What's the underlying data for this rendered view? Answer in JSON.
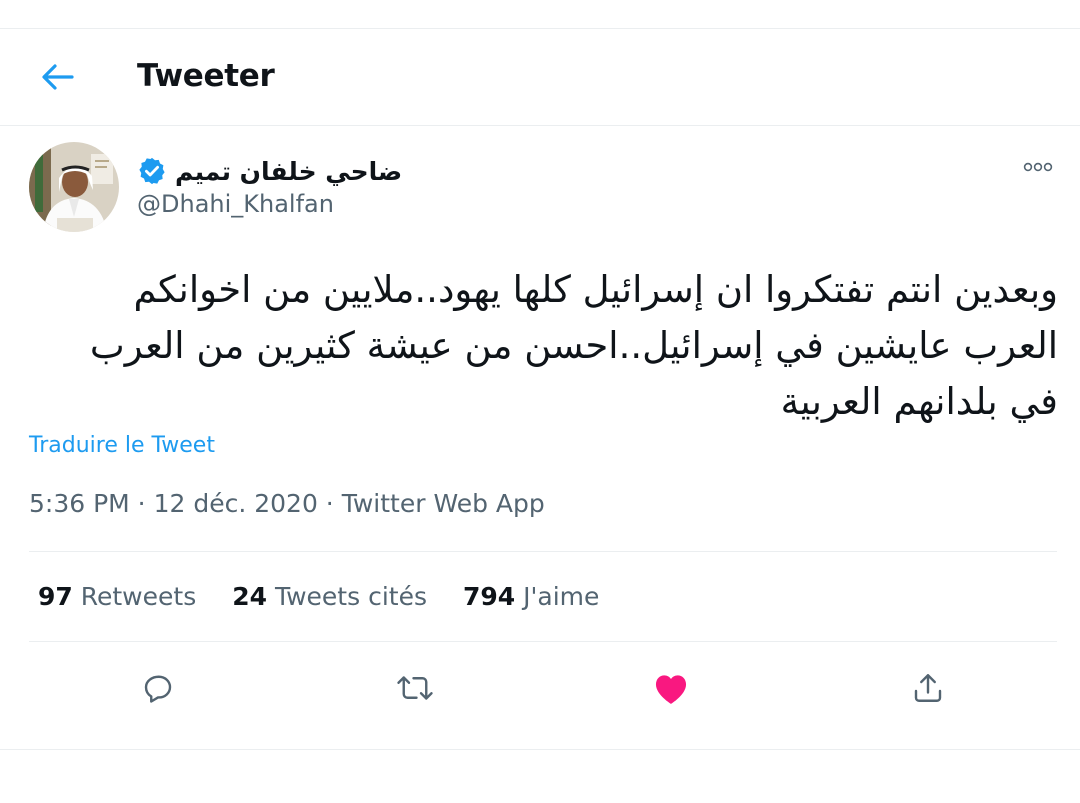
{
  "header": {
    "title": "Tweeter"
  },
  "tweet": {
    "author_name": "ضاحي خلفان تميم",
    "author_handle": "@Dhahi_Khalfan",
    "verified": true,
    "text_lines": [
      "وبعدين انتم تفتكروا ان إسرائيل  كلها يهود..ملايين من اخوانكم",
      "العرب عايشين في إسرائيل..احسن من عيشة كثيرين من العرب",
      "في بلدانهم العربية"
    ],
    "translate_label": "Traduire le Tweet",
    "time": "5:36 PM",
    "date": "12 déc. 2020",
    "source": "Twitter Web App",
    "separator": " · "
  },
  "stats": {
    "retweets_count": "97",
    "retweets_label": "Retweets",
    "quotes_count": "24",
    "quotes_label": "Tweets cités",
    "likes_count": "794",
    "likes_label": "J'aime"
  },
  "icons": {
    "back": "arrow-left-icon",
    "verified": "verified-badge-icon",
    "more": "more-options-icon",
    "reply": "reply-icon",
    "retweet": "retweet-icon",
    "like": "heart-icon",
    "share": "share-icon"
  },
  "colors": {
    "accent": "#1d9bf0",
    "like": "#f91880",
    "text": "#0f1419",
    "secondary": "#536471",
    "border": "#ebeef0"
  }
}
